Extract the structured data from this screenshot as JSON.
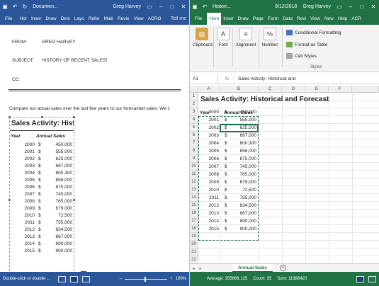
{
  "word": {
    "title": "Documen...",
    "user": "Greg Harvey",
    "tabs": [
      "File",
      "Hor",
      "Inser",
      "Draw",
      "Desi",
      "Layo",
      "Refer",
      "Maili",
      "Revie",
      "View",
      "ACRO"
    ],
    "tell_me": "Tell me",
    "header": {
      "from_label": "FROM:",
      "from_value": "GREG HARVEY",
      "subject_label": "SUBJECT:",
      "subject_value": "HISTORY OF RECENT SALES!",
      "cc_label": "CC:"
    },
    "body_text": "Compare our actual sales over the last few years to our forecasted sales. We c",
    "table": {
      "title": "Sales Activity: Hist",
      "col_year": "Year",
      "col_sales": "Annual Sales",
      "currency": "$",
      "rows": [
        {
          "year": "2000",
          "sales": "450,000"
        },
        {
          "year": "2001",
          "sales": "555,000"
        },
        {
          "year": "2002",
          "sales": "625,000"
        },
        {
          "year": "2003",
          "sales": "687,000"
        },
        {
          "year": "2004",
          "sales": "800,300"
        },
        {
          "year": "2005",
          "sales": "856,000"
        },
        {
          "year": "2006",
          "sales": "875,000"
        },
        {
          "year": "2007",
          "sales": "745,000"
        },
        {
          "year": "2008",
          "sales": "765,000"
        },
        {
          "year": "2009",
          "sales": "679,000"
        },
        {
          "year": "2010",
          "sales": "72,500"
        },
        {
          "year": "2011",
          "sales": "755,000"
        },
        {
          "year": "2012",
          "sales": "834,500"
        },
        {
          "year": "2013",
          "sales": "867,000"
        },
        {
          "year": "2014",
          "sales": "890,000"
        },
        {
          "year": "2015",
          "sales": "900,000"
        }
      ]
    },
    "status": "Double-click or double-...",
    "zoom": "100%"
  },
  "excel": {
    "title": "Histori...",
    "date": "8/12/2018",
    "user": "Greg Harvey",
    "tabs": [
      "File",
      "Hom",
      "Inser",
      "Draw",
      "Page",
      "Form",
      "Data",
      "Revi",
      "View",
      "New",
      "Help",
      "ACR"
    ],
    "ribbon": {
      "clipboard": "Clipboard",
      "font": "Font",
      "alignment": "Alignment",
      "number": "Number",
      "conditional_formatting": "Conditional Formatting",
      "format_as_table": "Format as Table",
      "cell_styles": "Cell Styles",
      "styles": "Styles"
    },
    "name_box": "A1",
    "fx": "fx",
    "formula": "Sales Activity: Historical and",
    "columns": [
      "A",
      "B",
      "C",
      "D",
      "E",
      "F"
    ],
    "sheet_title": "Sales Activity: Historical and Forecast",
    "col_year": "Year",
    "col_sales": "Annual Sales",
    "currency": "$",
    "row_numbers": [
      "1",
      "2",
      "3",
      "4",
      "5",
      "6",
      "7",
      "8",
      "9",
      "10",
      "11",
      "12",
      "13",
      "14",
      "15",
      "16",
      "17",
      "18",
      "19",
      "20",
      "21",
      "22"
    ],
    "sheet_tab": "Annual Sales",
    "status": {
      "average": "Average: 355888.125",
      "count": "Count: 35",
      "sum": "Sum: 11388420"
    }
  }
}
